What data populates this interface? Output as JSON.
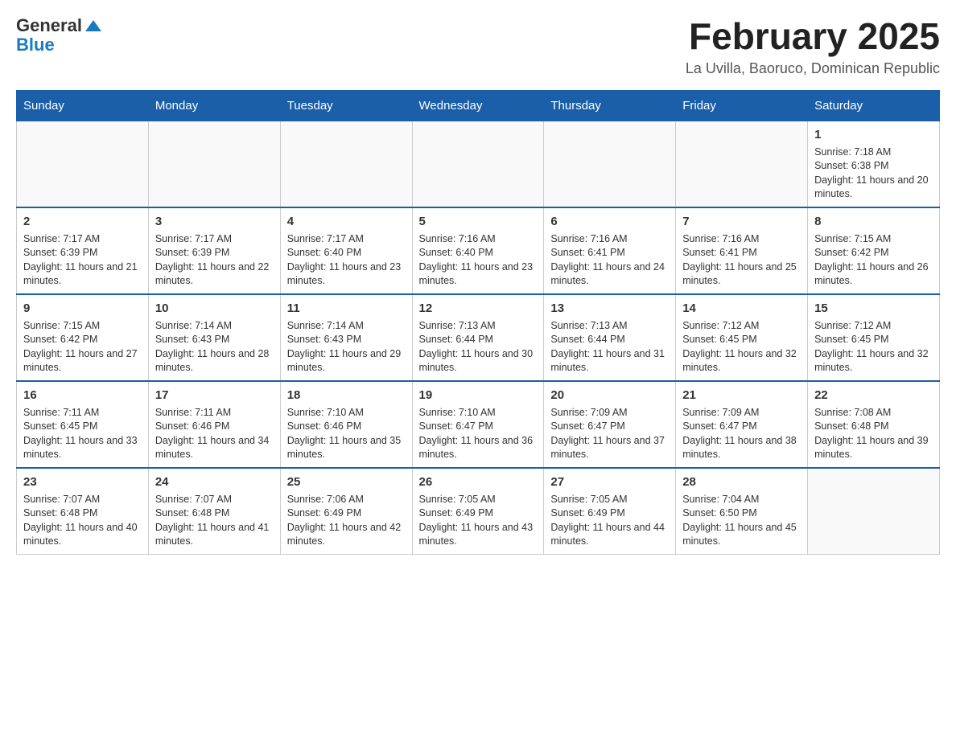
{
  "header": {
    "logo_general": "General",
    "logo_blue": "Blue",
    "month_title": "February 2025",
    "location": "La Uvilla, Baoruco, Dominican Republic"
  },
  "days_of_week": [
    "Sunday",
    "Monday",
    "Tuesday",
    "Wednesday",
    "Thursday",
    "Friday",
    "Saturday"
  ],
  "weeks": [
    [
      {
        "day": "",
        "info": ""
      },
      {
        "day": "",
        "info": ""
      },
      {
        "day": "",
        "info": ""
      },
      {
        "day": "",
        "info": ""
      },
      {
        "day": "",
        "info": ""
      },
      {
        "day": "",
        "info": ""
      },
      {
        "day": "1",
        "info": "Sunrise: 7:18 AM\nSunset: 6:38 PM\nDaylight: 11 hours and 20 minutes."
      }
    ],
    [
      {
        "day": "2",
        "info": "Sunrise: 7:17 AM\nSunset: 6:39 PM\nDaylight: 11 hours and 21 minutes."
      },
      {
        "day": "3",
        "info": "Sunrise: 7:17 AM\nSunset: 6:39 PM\nDaylight: 11 hours and 22 minutes."
      },
      {
        "day": "4",
        "info": "Sunrise: 7:17 AM\nSunset: 6:40 PM\nDaylight: 11 hours and 23 minutes."
      },
      {
        "day": "5",
        "info": "Sunrise: 7:16 AM\nSunset: 6:40 PM\nDaylight: 11 hours and 23 minutes."
      },
      {
        "day": "6",
        "info": "Sunrise: 7:16 AM\nSunset: 6:41 PM\nDaylight: 11 hours and 24 minutes."
      },
      {
        "day": "7",
        "info": "Sunrise: 7:16 AM\nSunset: 6:41 PM\nDaylight: 11 hours and 25 minutes."
      },
      {
        "day": "8",
        "info": "Sunrise: 7:15 AM\nSunset: 6:42 PM\nDaylight: 11 hours and 26 minutes."
      }
    ],
    [
      {
        "day": "9",
        "info": "Sunrise: 7:15 AM\nSunset: 6:42 PM\nDaylight: 11 hours and 27 minutes."
      },
      {
        "day": "10",
        "info": "Sunrise: 7:14 AM\nSunset: 6:43 PM\nDaylight: 11 hours and 28 minutes."
      },
      {
        "day": "11",
        "info": "Sunrise: 7:14 AM\nSunset: 6:43 PM\nDaylight: 11 hours and 29 minutes."
      },
      {
        "day": "12",
        "info": "Sunrise: 7:13 AM\nSunset: 6:44 PM\nDaylight: 11 hours and 30 minutes."
      },
      {
        "day": "13",
        "info": "Sunrise: 7:13 AM\nSunset: 6:44 PM\nDaylight: 11 hours and 31 minutes."
      },
      {
        "day": "14",
        "info": "Sunrise: 7:12 AM\nSunset: 6:45 PM\nDaylight: 11 hours and 32 minutes."
      },
      {
        "day": "15",
        "info": "Sunrise: 7:12 AM\nSunset: 6:45 PM\nDaylight: 11 hours and 32 minutes."
      }
    ],
    [
      {
        "day": "16",
        "info": "Sunrise: 7:11 AM\nSunset: 6:45 PM\nDaylight: 11 hours and 33 minutes."
      },
      {
        "day": "17",
        "info": "Sunrise: 7:11 AM\nSunset: 6:46 PM\nDaylight: 11 hours and 34 minutes."
      },
      {
        "day": "18",
        "info": "Sunrise: 7:10 AM\nSunset: 6:46 PM\nDaylight: 11 hours and 35 minutes."
      },
      {
        "day": "19",
        "info": "Sunrise: 7:10 AM\nSunset: 6:47 PM\nDaylight: 11 hours and 36 minutes."
      },
      {
        "day": "20",
        "info": "Sunrise: 7:09 AM\nSunset: 6:47 PM\nDaylight: 11 hours and 37 minutes."
      },
      {
        "day": "21",
        "info": "Sunrise: 7:09 AM\nSunset: 6:47 PM\nDaylight: 11 hours and 38 minutes."
      },
      {
        "day": "22",
        "info": "Sunrise: 7:08 AM\nSunset: 6:48 PM\nDaylight: 11 hours and 39 minutes."
      }
    ],
    [
      {
        "day": "23",
        "info": "Sunrise: 7:07 AM\nSunset: 6:48 PM\nDaylight: 11 hours and 40 minutes."
      },
      {
        "day": "24",
        "info": "Sunrise: 7:07 AM\nSunset: 6:48 PM\nDaylight: 11 hours and 41 minutes."
      },
      {
        "day": "25",
        "info": "Sunrise: 7:06 AM\nSunset: 6:49 PM\nDaylight: 11 hours and 42 minutes."
      },
      {
        "day": "26",
        "info": "Sunrise: 7:05 AM\nSunset: 6:49 PM\nDaylight: 11 hours and 43 minutes."
      },
      {
        "day": "27",
        "info": "Sunrise: 7:05 AM\nSunset: 6:49 PM\nDaylight: 11 hours and 44 minutes."
      },
      {
        "day": "28",
        "info": "Sunrise: 7:04 AM\nSunset: 6:50 PM\nDaylight: 11 hours and 45 minutes."
      },
      {
        "day": "",
        "info": ""
      }
    ]
  ]
}
